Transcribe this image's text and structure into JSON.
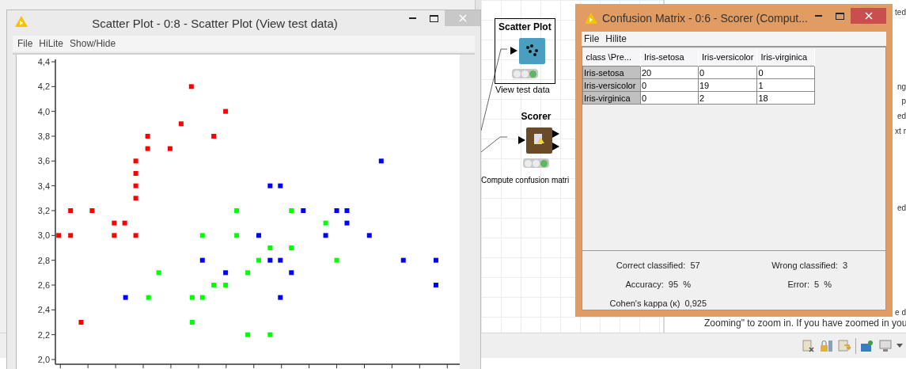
{
  "scatter_window": {
    "title": "Scatter Plot - 0:8 - Scatter Plot (View test data)",
    "menu": [
      "File",
      "HiLite",
      "Show/Hide"
    ],
    "plot": {
      "y_axis_labels": [
        "4,4",
        "4,2",
        "4,0",
        "3,8",
        "3,6",
        "3,4",
        "3,2",
        "3,0",
        "2,8",
        "2,6",
        "2,4",
        "2,2",
        "2,0"
      ]
    }
  },
  "workflow": {
    "nodes": [
      {
        "kind": "scatter",
        "title": "Scatter Plot",
        "label": "View test data",
        "selected": true,
        "executed": true
      },
      {
        "kind": "scorer",
        "title": "Scorer",
        "label": "Compute confusion matri",
        "selected": false,
        "executed": true
      }
    ]
  },
  "confusion_window": {
    "title": "Confusion Matrix - 0:6 - Scorer (Comput...",
    "menu": [
      "File",
      "Hilite"
    ],
    "table": {
      "columns": [
        "class \\Pre...",
        "Iris-setosa",
        "Iris-versicolor",
        "Iris-virginica"
      ],
      "rows": [
        [
          "Iris-setosa",
          "20",
          "0",
          "0"
        ],
        [
          "Iris-versicolor",
          "0",
          "19",
          "1"
        ],
        [
          "Iris-virginica",
          "0",
          "2",
          "18"
        ]
      ]
    },
    "stats": [
      "Correct classified:  57",
      "Wrong classified:  3",
      "Accuracy:  95  %",
      "Error:  5  %",
      "Cohen's kappa (κ)  0,925"
    ]
  },
  "description": {
    "fragments": [
      "ted",
      "ng",
      "p",
      "ed",
      "xt r",
      "ed",
      "e d"
    ],
    "line": "Zooming\" to zoom in. If you have zoomed in you"
  }
}
